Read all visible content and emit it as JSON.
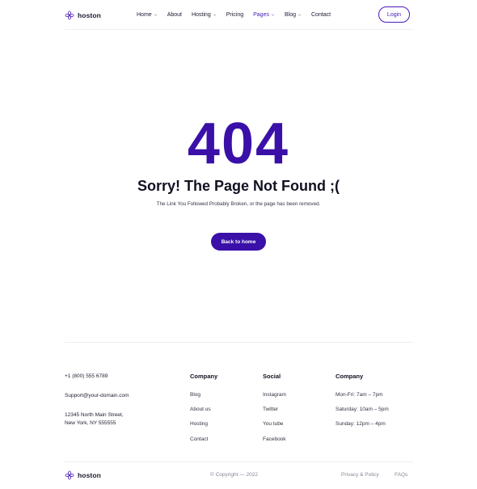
{
  "brand": {
    "name": "hoston",
    "accent_color": "#3a10a8",
    "logo_icon": "hexagon-flower-icon"
  },
  "nav": {
    "items": [
      {
        "label": "Home",
        "has_dropdown": true,
        "active": false
      },
      {
        "label": "About",
        "has_dropdown": false,
        "active": false
      },
      {
        "label": "Hosting",
        "has_dropdown": true,
        "active": false
      },
      {
        "label": "Pricing",
        "has_dropdown": false,
        "active": false
      },
      {
        "label": "Pages",
        "has_dropdown": true,
        "active": true
      },
      {
        "label": "Blog",
        "has_dropdown": true,
        "active": false
      },
      {
        "label": "Contact",
        "has_dropdown": false,
        "active": false
      }
    ],
    "login_label": "Login"
  },
  "error": {
    "code": "404",
    "title": "Sorry! The Page Not Found ;(",
    "description": "The Link You Followed Probably Broken, or the page has been removed.",
    "back_label": "Back to home"
  },
  "footer": {
    "contact": {
      "phone": "+1 (800) 555 6789",
      "email": "Support@your-domain.com",
      "address_line1": "12345 North Main Street,",
      "address_line2": "New York, NY 555555"
    },
    "company": {
      "heading": "Company",
      "links": [
        "Blog",
        "About us",
        "Hosting",
        "Contact"
      ]
    },
    "social": {
      "heading": "Social",
      "links": [
        "Instagram",
        "Twitter",
        "You tube",
        "Facebook"
      ]
    },
    "hours": {
      "heading": "Company",
      "lines": [
        "Mon-Fri: 7am – 7pm",
        "Saturday: 10am – 5pm",
        "Sunday: 12pm – 4pm"
      ]
    },
    "copyright": "© Copyright — 2022",
    "privacy_label": "Privacy & Policy",
    "faqs_label": "FAQs"
  }
}
